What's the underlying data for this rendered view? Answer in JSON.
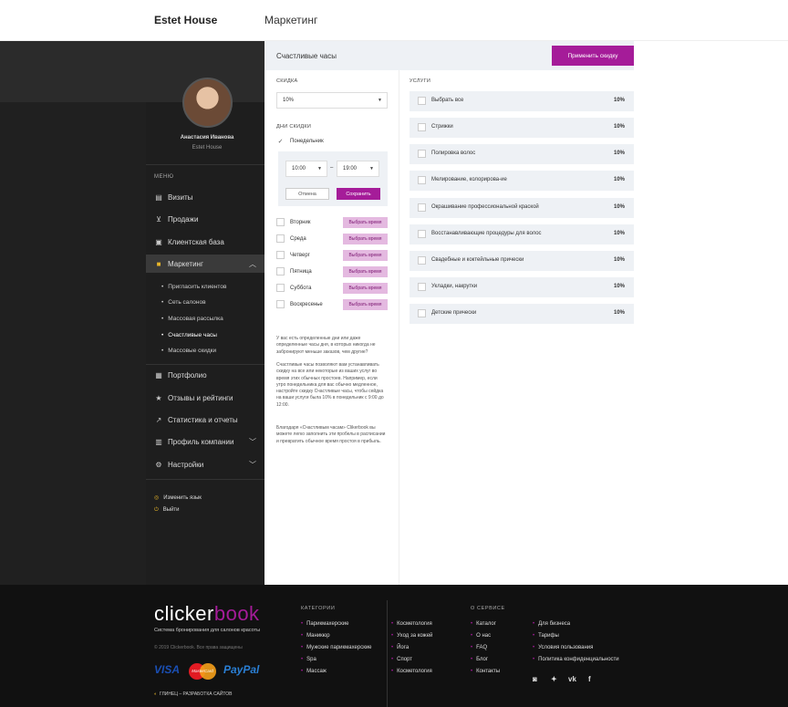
{
  "header": {
    "brand": "Estet House",
    "section": "Маркетинг"
  },
  "user": {
    "name": "Анастасия Иванова",
    "company": "Estet House"
  },
  "menu": {
    "title": "МЕНЮ",
    "items": [
      {
        "label": "Визиты",
        "icon": "clipboard-icon"
      },
      {
        "label": "Продажи",
        "icon": "cart-icon"
      },
      {
        "label": "Клиентская база",
        "icon": "contacts-icon"
      },
      {
        "label": "Маркетинг",
        "icon": "briefcase-icon"
      },
      {
        "label": "Портфолио",
        "icon": "gallery-icon"
      },
      {
        "label": "Отзывы и рейтинги",
        "icon": "star-icon"
      },
      {
        "label": "Статистика и отчеты",
        "icon": "chart-icon"
      },
      {
        "label": "Профиль компании",
        "icon": "profile-icon"
      },
      {
        "label": "Настройки",
        "icon": "gear-icon"
      }
    ],
    "marketing_sub": [
      "Пригласить клиентов",
      "Сеть салонов",
      "Массовая рассылка",
      "Счастливые часы",
      "Массовые скидки"
    ],
    "change_lang": "Изменить язык",
    "logout": "Выйти"
  },
  "panel": {
    "title": "Счастливые часы",
    "apply_label": "Применить скидку",
    "discount_label": "СКИДКА",
    "discount_value": "10%",
    "days_label": "ДНИ СКИДКИ",
    "monday": "Понедельник",
    "time_from": "10:00",
    "time_dash": "–",
    "time_to": "19:00",
    "cancel": "Отмена",
    "save": "Сохранить",
    "days": [
      "Вторник",
      "Среда",
      "Четверг",
      "Пятница",
      "Суббота",
      "Воскресенье"
    ],
    "pick_label": "Выбрать время",
    "notes": [
      "У вас есть определенные дни или даже определенные часы дня, в которых никогда не забронируют меньше заказов, чем другие?",
      "Счастливые часы позволяют вам устанавливать скидку на все или некоторые из ваших услуг во время этих обычных простоев. Например, если утро понедельника для вас обычно медленное, настройте скидку Счастливые часы, чтобы сейдка на ваши услуги была 10% в понедельник с 9:00 до 12:00.",
      "Благодаря «Счастливым часам» Clikerbook вы можете легко заполнить эти пробелы в расписании и превратить обычное время простоя в прибыль."
    ],
    "services_label": "УСЛУГИ",
    "services": [
      {
        "name": "Выбрать все",
        "pct": "10%"
      },
      {
        "name": "Стрижки",
        "pct": "10%"
      },
      {
        "name": "Полировка волос",
        "pct": "10%"
      },
      {
        "name": "Мелирование, колорирова-ие",
        "pct": "10%"
      },
      {
        "name": "Окрашивание профессиональной краской",
        "pct": "10%"
      },
      {
        "name": "Восстанавливающие процедуры для волос",
        "pct": "10%"
      },
      {
        "name": "Свадебные и коктейльные прически",
        "pct": "10%"
      },
      {
        "name": "Укладки, накрутки",
        "pct": "10%"
      },
      {
        "name": "Детские прически",
        "pct": "10%"
      }
    ]
  },
  "footer": {
    "logo_a": "clicker",
    "logo_b": "book",
    "tagline": "Система бронирования для салонов красоты",
    "copyright": "© 2019 Clickerbook. Все права защищены",
    "payments": {
      "visa": "VISA",
      "mastercard": "MasterCard",
      "paypal": "PayPal"
    },
    "studio": "ГЛИНЕЦ – РАЗРАБОТКА САЙТОВ",
    "categories_title": "КАТЕГОРИИ",
    "categories_col1": [
      "Парикмахерские",
      "Маникюр",
      "Мужские парикмахерские",
      "Spa",
      "Массаж"
    ],
    "categories_col2": [
      "Косметология",
      "Уход за кожей",
      "Йога",
      "Спорт",
      "Косметология"
    ],
    "about_title": "О СЕРВИСЕ",
    "about_col1": [
      "Каталог",
      "О нас",
      "FAQ",
      "Блог",
      "Контакты"
    ],
    "about_col2": [
      "Для бизнеса",
      "Тарифы",
      "Условия пользования",
      "Политика конфиденциальности"
    ],
    "social": [
      "instagram-icon",
      "twitter-icon",
      "vk-icon",
      "facebook-icon"
    ]
  }
}
